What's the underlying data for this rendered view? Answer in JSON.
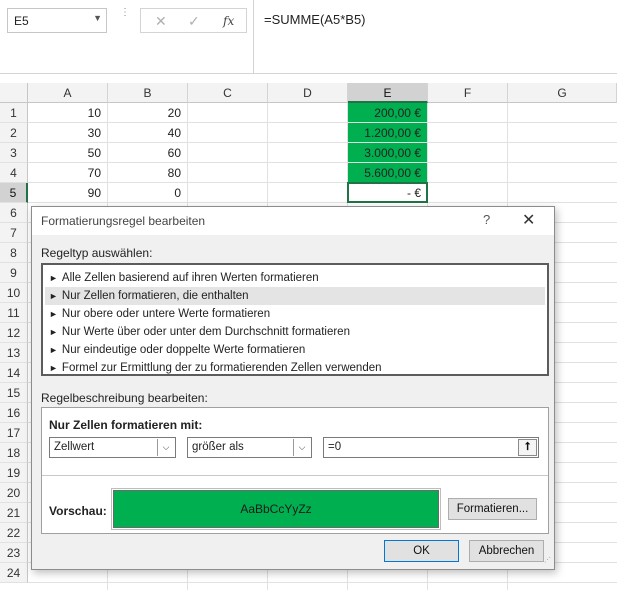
{
  "formula_bar": {
    "name_box": "E5",
    "cancel_icon": "✕",
    "enter_icon": "✓",
    "function_icon": "fx",
    "formula": "=SUMME(A5*B5)"
  },
  "sheet": {
    "columns": [
      "A",
      "B",
      "C",
      "D",
      "E",
      "F",
      "G"
    ],
    "rows": [
      "1",
      "2",
      "3",
      "4",
      "5",
      "6",
      "7",
      "8",
      "9",
      "10",
      "11",
      "12",
      "13",
      "14",
      "15",
      "16",
      "17",
      "18",
      "19",
      "20",
      "21",
      "22",
      "23",
      "24"
    ],
    "col_a": [
      "10",
      "30",
      "50",
      "70",
      "90"
    ],
    "col_b": [
      "20",
      "40",
      "60",
      "80",
      "0"
    ],
    "col_e": [
      "200,00 €",
      "1.200,00 €",
      "3.000,00 €",
      "5.600,00 €",
      "-    €"
    ],
    "highlight_color": "#00b050"
  },
  "dialog": {
    "title": "Formatierungsregel bearbeiten",
    "help_icon": "?",
    "close_icon": "✕",
    "rule_type_label": "Regeltyp auswählen:",
    "rule_types": [
      "Alle Zellen basierend auf ihren Werten formatieren",
      "Nur Zellen formatieren, die enthalten",
      "Nur obere oder untere Werte formatieren",
      "Nur Werte über oder unter dem Durchschnitt formatieren",
      "Nur eindeutige oder doppelte Werte formatieren",
      "Formel zur Ermittlung der zu formatierenden Zellen verwenden"
    ],
    "selected_rule_type": "Nur Zellen formatieren, die enthalten",
    "edit_description_label": "Regelbeschreibung bearbeiten:",
    "format_only_label": "Nur Zellen formatieren mit:",
    "condition_field": "Zellwert",
    "operator": "größer als",
    "value": "=0",
    "preview_label": "Vorschau:",
    "preview_text": "AaBbCcYyZz",
    "preview_color": "#00b050",
    "format_button": "Formatieren...",
    "ok_button": "OK",
    "cancel_button": "Abbrechen"
  }
}
